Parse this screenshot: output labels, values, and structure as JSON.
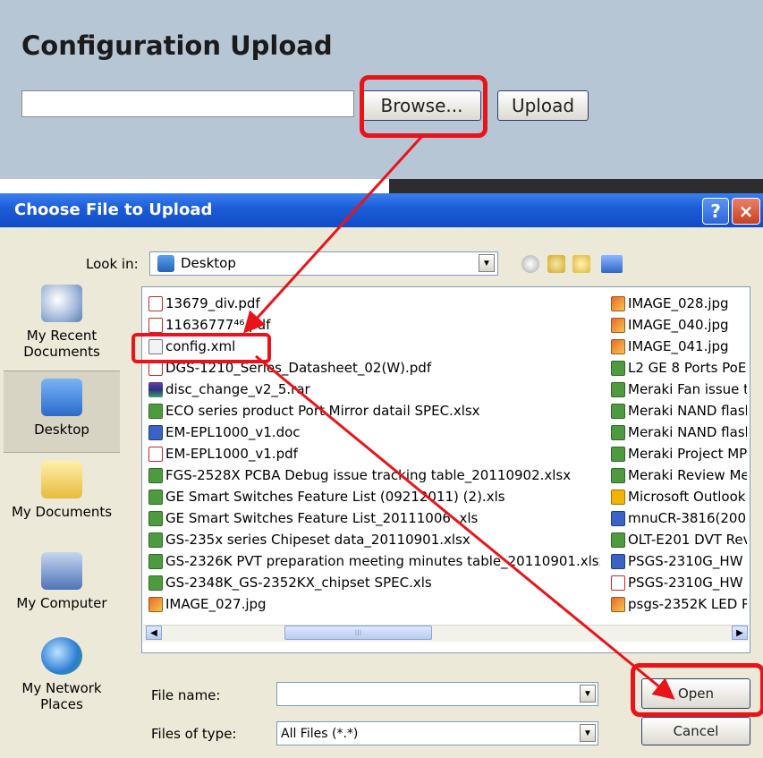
{
  "upload_panel": {
    "title": "Configuration Upload",
    "file_path_value": "",
    "browse_label": "Browse...",
    "upload_label": "Upload"
  },
  "dialog": {
    "title": "Choose File to Upload",
    "help_label": "?",
    "close_label": "×",
    "look_in_label": "Look in:",
    "look_in_value": "Desktop",
    "places": [
      {
        "label": "My Recent Documents",
        "icon": "clock-documents-icon"
      },
      {
        "label": "Desktop",
        "icon": "desktop-icon"
      },
      {
        "label": "My Documents",
        "icon": "folder-documents-icon"
      },
      {
        "label": "My Computer",
        "icon": "computer-icon"
      },
      {
        "label": "My Network Places",
        "icon": "network-icon"
      }
    ],
    "files_left": [
      {
        "name": "13679_div.pdf",
        "type": "pdf"
      },
      {
        "name": "11636777⁴⁶.pdf",
        "type": "pdf"
      },
      {
        "name": "config.xml",
        "type": "xml"
      },
      {
        "name": "DGS-1210_Series_Datasheet_02(W).pdf",
        "type": "pdf"
      },
      {
        "name": "disc_change_v2_5.rar",
        "type": "rar"
      },
      {
        "name": "ECO series product Port Mirror datail SPEC.xlsx",
        "type": "xls"
      },
      {
        "name": "EM-EPL1000_v1.doc",
        "type": "doc"
      },
      {
        "name": "EM-EPL1000_v1.pdf",
        "type": "pdf"
      },
      {
        "name": "FGS-2528X PCBA Debug issue tracking table_20110902.xlsx",
        "type": "xls"
      },
      {
        "name": "GE Smart Switches Feature List (09212011) (2).xls",
        "type": "xls"
      },
      {
        "name": "GE Smart Switches Feature List_20111006 .xls",
        "type": "xls"
      },
      {
        "name": "GS-235x series Chipeset data_20110901.xlsx",
        "type": "xls"
      },
      {
        "name": "GS-2326K PVT preparation meeting minutes table_20110901.xlsx",
        "type": "xls"
      },
      {
        "name": "GS-2348K_GS-2352KX_chipset SPEC.xls",
        "type": "xls"
      },
      {
        "name": "IMAGE_027.jpg",
        "type": "jpg"
      }
    ],
    "files_right": [
      {
        "name": "IMAGE_028.jpg",
        "type": "jpg"
      },
      {
        "name": "IMAGE_040.jpg",
        "type": "jpg"
      },
      {
        "name": "IMAGE_041.jpg",
        "type": "jpg"
      },
      {
        "name": "L2 GE 8 Ports PoE",
        "type": "xls"
      },
      {
        "name": "Meraki Fan issue t",
        "type": "xls"
      },
      {
        "name": "Meraki NAND flash",
        "type": "xls"
      },
      {
        "name": "Meraki NAND flash",
        "type": "xls"
      },
      {
        "name": "Meraki Project MP",
        "type": "xls"
      },
      {
        "name": "Meraki Review Me",
        "type": "xls"
      },
      {
        "name": "Microsoft Outlook",
        "type": "pst"
      },
      {
        "name": "mnuCR-3816(2008",
        "type": "doc"
      },
      {
        "name": "OLT-E201 DVT Rev",
        "type": "xls"
      },
      {
        "name": "PSGS-2310G_HW I",
        "type": "doc"
      },
      {
        "name": "PSGS-2310G_HW I",
        "type": "pdf"
      },
      {
        "name": "psgs-2352K LED Pr",
        "type": "jpg"
      }
    ],
    "scroll_grip": "III",
    "file_name_label": "File name:",
    "file_name_value": "",
    "files_of_type_label": "Files of type:",
    "files_of_type_value": "All Files (*.*)",
    "open_label": "Open",
    "cancel_label": "Cancel"
  },
  "colors": {
    "highlight": "#e8141a",
    "titlebar": "#1b5cd6",
    "panel_bg": "#b7c6d5",
    "dialog_bg": "#ece9d8"
  }
}
